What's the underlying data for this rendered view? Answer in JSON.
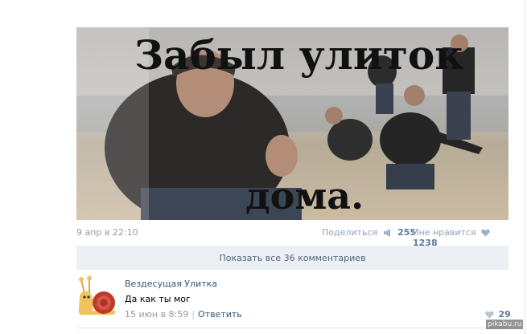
{
  "post": {
    "meme_line_top": "Забыл улиток",
    "meme_line_bottom": "дома.",
    "date": "9 апр в 22:10",
    "share_label": "Поделиться",
    "share_count": "255",
    "like_label": "Мне нравится",
    "like_count": "1238",
    "icons": {
      "share": "megaphone-icon",
      "like": "heart-icon"
    }
  },
  "comments_bar": {
    "label": "Показать все 36 комментариев"
  },
  "comment": {
    "author": "Вездесущая Улитка",
    "text": "Да как ты мог",
    "time": "15 июн в 8:59",
    "separator": "|",
    "reply_label": "Ответить",
    "like_count": "29"
  },
  "watermark": "pikabu.ru",
  "colors": {
    "link": "#2b587a",
    "meta": "#999999",
    "bar_bg": "#eceff3",
    "count": "#5d7a99"
  }
}
